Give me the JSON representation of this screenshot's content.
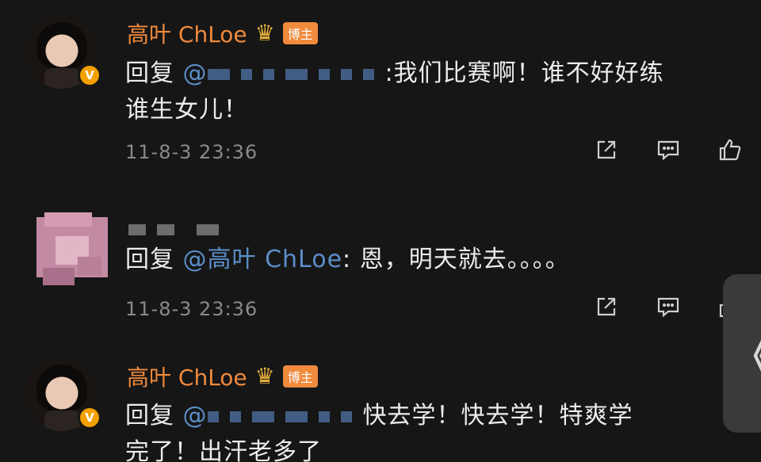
{
  "comments": [
    {
      "username": "高叶 ChLoe",
      "tag": "博主",
      "reply_prefix": "回复 ",
      "reply_at": "@",
      "text_line1": ":我们比赛啊！谁不好好练",
      "text_line2": "谁生女儿！",
      "timestamp": "11-8-3 23:36",
      "verified_badge": "V"
    },
    {
      "reply_prefix": "回复 ",
      "reply_mention": "@高叶 ChLoe",
      "text": ": 恩，明天就去。。。。",
      "timestamp": "11-8-3 23:36"
    },
    {
      "username": "高叶 ChLoe",
      "tag": "博主",
      "reply_prefix": "回复 ",
      "reply_at": "@",
      "text_line1": "快去学！快去学！特爽学",
      "text_line2": "完了！出汗老多了",
      "verified_badge": "V"
    }
  ],
  "side_handle": {
    "glyph": "《"
  },
  "icons": [
    "share-icon",
    "comment-icon",
    "like-icon",
    "crown-icon"
  ],
  "colors": {
    "username": "#f08a3c",
    "mention": "#5b8ec9",
    "background": "#161616"
  }
}
